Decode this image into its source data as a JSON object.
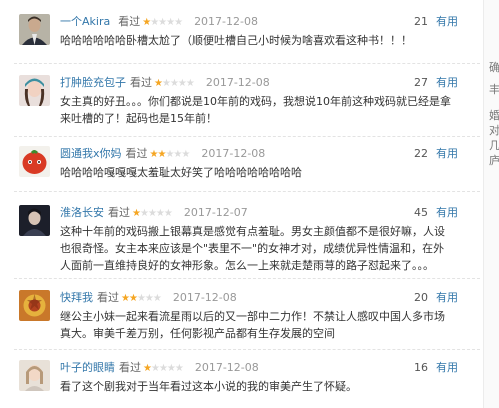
{
  "useful_label": "有用",
  "rated_label": "看过",
  "reviews": [
    {
      "user": "一个Akira",
      "stars": 1,
      "date": "2017-12-08",
      "votes": "21",
      "text": "哈哈哈哈哈哈卧槽太尬了（顺便吐槽自己小时候为啥喜欢看这种书！！！"
    },
    {
      "user": "打肿脸充包子",
      "stars": 1,
      "date": "2017-12-08",
      "votes": "27",
      "text": "女主真的好丑。。。你们都说是10年前的戏码，我想说10年前这种戏码就已经是拿来吐槽的了！起码也是15年前！"
    },
    {
      "user": "圆通我x你妈",
      "stars": 2,
      "date": "2017-12-08",
      "votes": "22",
      "text": "哈哈哈哈嘎嘎嘎太羞耻太好笑了哈哈哈哈哈哈哈哈"
    },
    {
      "user": "淮洛长安",
      "stars": 1,
      "date": "2017-12-07",
      "votes": "45",
      "text": "这种十年前的戏码搬上银幕真是感觉有点羞耻。男女主颜值都不是很好嘛，人设也很奇怪。女主本来应该是个\"表里不一\"的女神才对，成绩优异性情温和，在外人面前一直维持良好的女神形象。怎么一上来就走楚雨荨的路子怼起来了。。。"
    },
    {
      "user": "快拜我",
      "stars": 2,
      "date": "2017-12-08",
      "votes": "20",
      "text": "继公主小妹一起来看流星雨以后的又一部中二力作！不禁让人感叹中国人多市场真大。审美千差万别，任何影视产品都有生存发展的空间"
    },
    {
      "user": "叶子的眼睛",
      "stars": 1,
      "date": "2017-12-08",
      "votes": "16",
      "text": "看了这个剧我对于当年看过这本小说的我的审美产生了怀疑。"
    }
  ],
  "right_edge_chars": [
    "确",
    "丰",
    "婚",
    "对",
    "几",
    "庐"
  ]
}
